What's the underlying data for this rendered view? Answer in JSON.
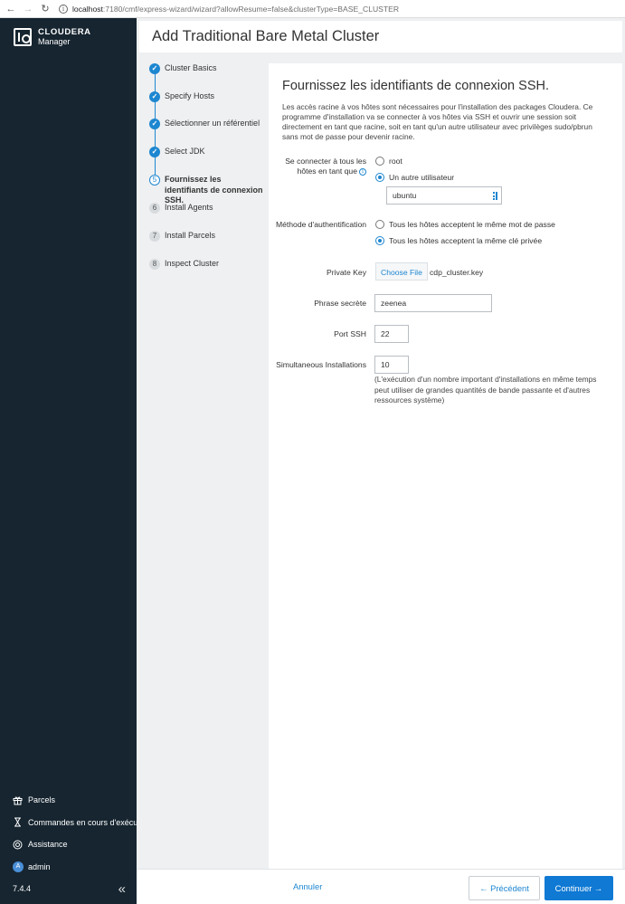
{
  "browser": {
    "back_glyph": "←",
    "forward_glyph": "→",
    "reload_glyph": "↻",
    "url_host": "localhost",
    "url_path": ":7180/cmf/express-wizard/wizard?allowResume=false&clusterType=BASE_CLUSTER"
  },
  "sidebar": {
    "brand": "CLOUDERA",
    "product": "Manager",
    "items": [
      {
        "label": "Parcels",
        "icon": "gift-icon"
      },
      {
        "label": "Commandes en cours d'exécution",
        "icon": "hourglass-icon"
      },
      {
        "label": "Assistance",
        "icon": "help-circle-icon"
      },
      {
        "label": "admin",
        "icon": "avatar",
        "avatar_letter": "A"
      }
    ],
    "version": "7.4.4",
    "collapse_glyph": "«"
  },
  "header": {
    "title": "Add Traditional Bare Metal Cluster"
  },
  "steps": [
    {
      "number": "1",
      "label": "Cluster Basics",
      "state": "done"
    },
    {
      "number": "2",
      "label": "Specify Hosts",
      "state": "done"
    },
    {
      "number": "3",
      "label": "Sélectionner un référentiel",
      "state": "done"
    },
    {
      "number": "4",
      "label": "Select JDK",
      "state": "done"
    },
    {
      "number": "5",
      "label": "Fournissez les identifiants de connexion SSH.",
      "state": "active"
    },
    {
      "number": "6",
      "label": "Install Agents",
      "state": "pending"
    },
    {
      "number": "7",
      "label": "Install Parcels",
      "state": "pending"
    },
    {
      "number": "8",
      "label": "Inspect Cluster",
      "state": "pending"
    }
  ],
  "form": {
    "title": "Fournissez les identifiants de connexion SSH.",
    "description": "Les accès racine à vos hôtes sont nécessaires pour l'installation des packages Cloudera. Ce programme d'installation va se connecter à vos hôtes via SSH et ouvrir une session soit directement en tant que racine, soit en tant qu'un autre utilisateur avec privilèges sudo/pbrun sans mot de passe pour devenir racine.",
    "login_label": "Se connecter à tous les hôtes en tant que",
    "login_options": [
      {
        "label": "root",
        "checked": false
      },
      {
        "label": "Un autre utilisateur",
        "checked": true
      }
    ],
    "username_value": "ubuntu",
    "auth_label": "Méthode d'authentification",
    "auth_options": [
      {
        "label": "Tous les hôtes acceptent le même mot de passe",
        "checked": false
      },
      {
        "label": "Tous les hôtes acceptent la même clé privée",
        "checked": true
      }
    ],
    "private_key_label": "Private Key",
    "choose_file_label": "Choose File",
    "file_name": "cdp_cluster.key",
    "passphrase_label": "Phrase secrète",
    "passphrase_value": "zeenea",
    "port_label": "Port SSH",
    "port_value": "22",
    "simultaneous_label": "Simultaneous Installations",
    "simultaneous_value": "10",
    "simultaneous_hint": "(L'exécution d'un nombre important d'installations en même temps peut utiliser de grandes quantités de bande passante et d'autres ressources système)"
  },
  "footer": {
    "cancel_label": "Annuler",
    "prev_label": "← Précédent",
    "next_label": "Continuer →"
  },
  "colors": {
    "accent": "#1d86d0",
    "sidebar_bg": "#162530",
    "primary_button": "#0f79d4"
  }
}
